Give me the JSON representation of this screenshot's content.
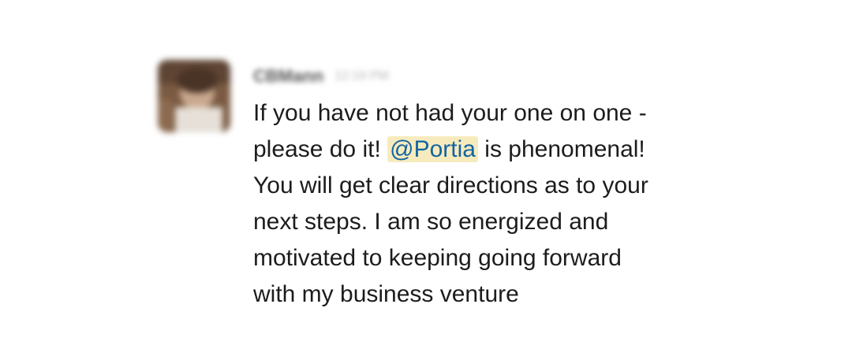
{
  "message": {
    "sender": "CBMann",
    "timestamp": "12:19 PM",
    "body": {
      "line1": "If you have not had your one on one -",
      "line2_before": "please do it! ",
      "mention": "@Portia",
      "line2_after": " is phenomenal!",
      "line3": "You will get clear directions as to your",
      "line4": "next steps. I am so energized and",
      "line5": "motivated to keeping going forward",
      "line6": "with my business venture"
    }
  },
  "colors": {
    "mention_background": "#f7ebbd",
    "mention_text": "#1264a3",
    "message_text": "#1d1c1d"
  }
}
